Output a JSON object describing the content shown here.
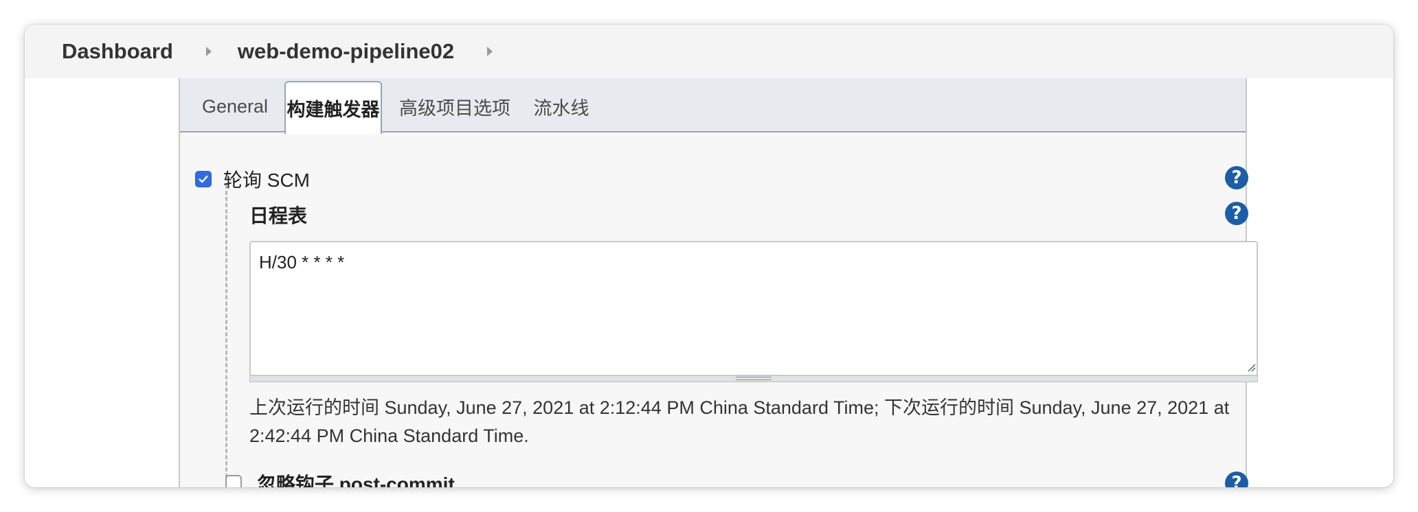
{
  "breadcrumb": {
    "items": [
      {
        "label": "Dashboard"
      },
      {
        "label": "web-demo-pipeline02"
      }
    ]
  },
  "tabs": [
    {
      "label": "General",
      "active": false
    },
    {
      "label": "构建触发器",
      "active": true
    },
    {
      "label": "高级项目选项",
      "active": false
    },
    {
      "label": "流水线",
      "active": false
    }
  ],
  "poll_scm": {
    "label": "轮询 SCM",
    "checked": true,
    "schedule_label": "日程表",
    "schedule_value": "H/30 * * * *",
    "run_info": "上次运行的时间 Sunday, June 27, 2021 at 2:12:44 PM China Standard Time; 下次运行的时间 Sunday, June 27, 2021 at 2:42:44 PM China Standard Time."
  },
  "ignore_hooks": {
    "label": "忽略钩子 post-commit",
    "checked": false
  },
  "help": {
    "symbol": "?",
    "icon": "help-icon"
  },
  "colors": {
    "checkbox_accent": "#2f6de1",
    "help_icon": "#1c5ea6",
    "tabbar_bg": "#e7ebef",
    "breadcrumb_bg": "#f4f4f4"
  }
}
